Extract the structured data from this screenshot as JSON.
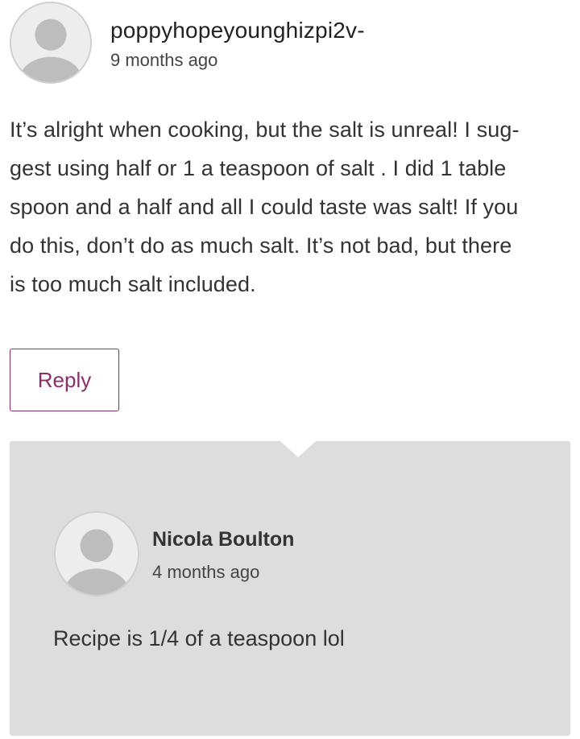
{
  "comment": {
    "author": "poppyhopeyounghizpi2v-",
    "time": "9 months ago",
    "body_lines": [
      "It’s alright when cooking, but the salt is unreal! I sug-",
      "gest using half or 1 a teaspoon of salt . I did 1 table",
      "spoon and a half and all I could taste was salt! If you",
      "do this, don’t do as much salt. It’s not bad, but there",
      "is too much salt included."
    ],
    "reply_label": "Reply"
  },
  "reply": {
    "author": "Nicola Boulton",
    "time": "4 months ago",
    "body": "Recipe is 1/4 of a teaspoon lol"
  },
  "colors": {
    "accent": "#8a2d68",
    "reply_background": "#dddddd",
    "avatar_placeholder": "#bdbdbd"
  },
  "icons": {
    "avatar": "user-placeholder-icon"
  }
}
